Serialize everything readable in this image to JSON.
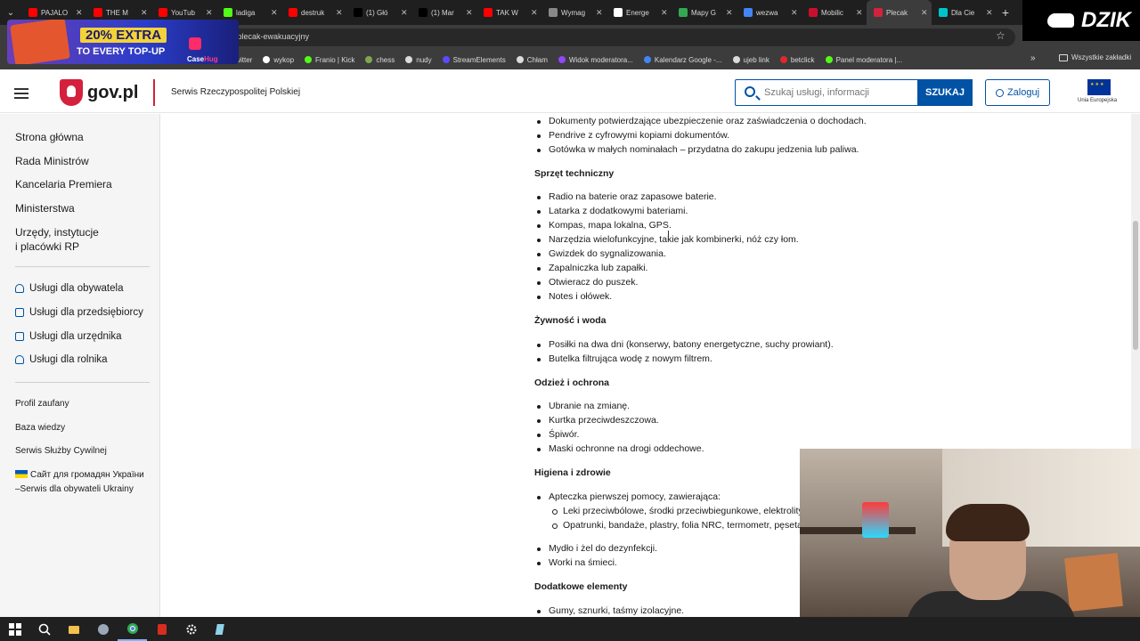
{
  "browser": {
    "tabs": [
      {
        "title": "PAJALO",
        "color": "#ff0000"
      },
      {
        "title": "THE M",
        "color": "#ff0000"
      },
      {
        "title": "YouTub",
        "color": "#ff0000"
      },
      {
        "title": "ladiga",
        "color": "#53fc18"
      },
      {
        "title": "destruk",
        "color": "#ff0000"
      },
      {
        "title": "(1) Głó",
        "color": "#000000"
      },
      {
        "title": "(1) Mar",
        "color": "#000000"
      },
      {
        "title": "TAK W",
        "color": "#ff0000"
      },
      {
        "title": "Wymag",
        "color": "#888888"
      },
      {
        "title": "Energe",
        "color": "#ffffff"
      },
      {
        "title": "Mapy G",
        "color": "#34a853"
      },
      {
        "title": "wezwa",
        "color": "#4285f4"
      },
      {
        "title": "Mobilic",
        "color": "#c8102e"
      },
      {
        "title": "Plecak",
        "color": "#d4213d"
      },
      {
        "title": "Dla Cie",
        "color": "#00c4cc"
      }
    ],
    "active_tab_index": 13,
    "url": "i/plecak-ewakuacyjny",
    "bookmarks": [
      {
        "label": "twitter",
        "color": "#ffffff"
      },
      {
        "label": "wykop",
        "color": "#ffffff"
      },
      {
        "label": "Franio | Kick",
        "color": "#53fc18"
      },
      {
        "label": "chess",
        "color": "#7fa650"
      },
      {
        "label": "nudy",
        "color": "#dcdcdc"
      },
      {
        "label": "StreamElements",
        "color": "#5b4bff"
      },
      {
        "label": "Chłam",
        "color": "#dcdcdc"
      },
      {
        "label": "Widok moderatora...",
        "color": "#9146ff"
      },
      {
        "label": "Kalendarz Google -...",
        "color": "#4285f4"
      },
      {
        "label": "ujeb link",
        "color": "#dcdcdc"
      },
      {
        "label": "betclick",
        "color": "#e0282e"
      },
      {
        "label": "Panel moderatora |...",
        "color": "#53fc18"
      }
    ],
    "all_bookmarks": "Wszystkie zakładki"
  },
  "overlay": {
    "promo_line1": "20% EXTRA",
    "promo_line2": "TO EVERY TOP-UP",
    "promo_brand_a": "Case",
    "promo_brand_b": "Hug",
    "streamer_logo": "DZIK"
  },
  "header": {
    "logo": "gov.pl",
    "subtitle": "Serwis Rzeczypospolitej Polskiej",
    "search_placeholder": "Szukaj usługi, informacji",
    "search_button": "SZUKAJ",
    "login_button": "Zaloguj",
    "eu_label": "Unia Europejska"
  },
  "sidebar": {
    "main": [
      "Strona główna",
      "Rada Ministrów",
      "Kancelaria Premiera",
      "Ministerstwa",
      "Urzędy, instytucje",
      "i placówki RP"
    ],
    "services": [
      "Usługi dla obywatela",
      "Usługi dla przedsiębiorcy",
      "Usługi dla urzędnika",
      "Usługi dla rolnika"
    ],
    "extra": [
      "Profil zaufany",
      "Baza wiedzy",
      "Serwis Służby Cywilnej",
      "Сайт для громадян України",
      "–Serwis dla obywateli Ukrainy"
    ]
  },
  "content": {
    "docs_items": [
      "Dokumenty potwierdzające ubezpieczenie oraz zaświadczenia o dochodach.",
      "Pendrive z cyfrowymi kopiami dokumentów.",
      "Gotówka w małych nominałach – przydatna do zakupu jedzenia lub paliwa."
    ],
    "h_tech": "Sprzęt techniczny",
    "tech_items": [
      "Radio na baterie oraz zapasowe baterie.",
      "Latarka z dodatkowymi bateriami.",
      "Kompas, mapa lokalna, GPS.",
      "Narzędzia wielofunkcyjne, takie jak kombinerki, nóż czy łom.",
      "Gwizdek do sygnalizowania.",
      "Zapalniczka lub zapałki.",
      "Otwieracz do puszek.",
      "Notes i ołówek."
    ],
    "h_food": "Żywność i woda",
    "food_items": [
      "Posiłki na dwa dni (konserwy, batony energetyczne, suchy prowiant).",
      "Butelka filtrująca wodę z nowym filtrem."
    ],
    "h_clothes": "Odzież i ochrona",
    "clothes_items": [
      "Ubranie na zmianę.",
      "Kurtka przeciwdeszczowa.",
      "Śpiwór.",
      "Maski ochronne na drogi oddechowe."
    ],
    "h_hygiene": "Higiena i zdrowie",
    "hygiene_items": [
      "Apteczka pierwszej pomocy, zawierająca:",
      "Mydło i żel do dezynfekcji.",
      "Worki na śmieci."
    ],
    "hygiene_sub": [
      "Leki przeciwbólowe, środki przeciwbiegunkowe, elektrolity",
      "Opatrunki, bandaże, plastry, folia NRC, termometr, pęseta."
    ],
    "h_extra": "Dodatkowe elementy",
    "extra_items": [
      "Gumy, sznurki, taśmy izolacyjne."
    ]
  }
}
